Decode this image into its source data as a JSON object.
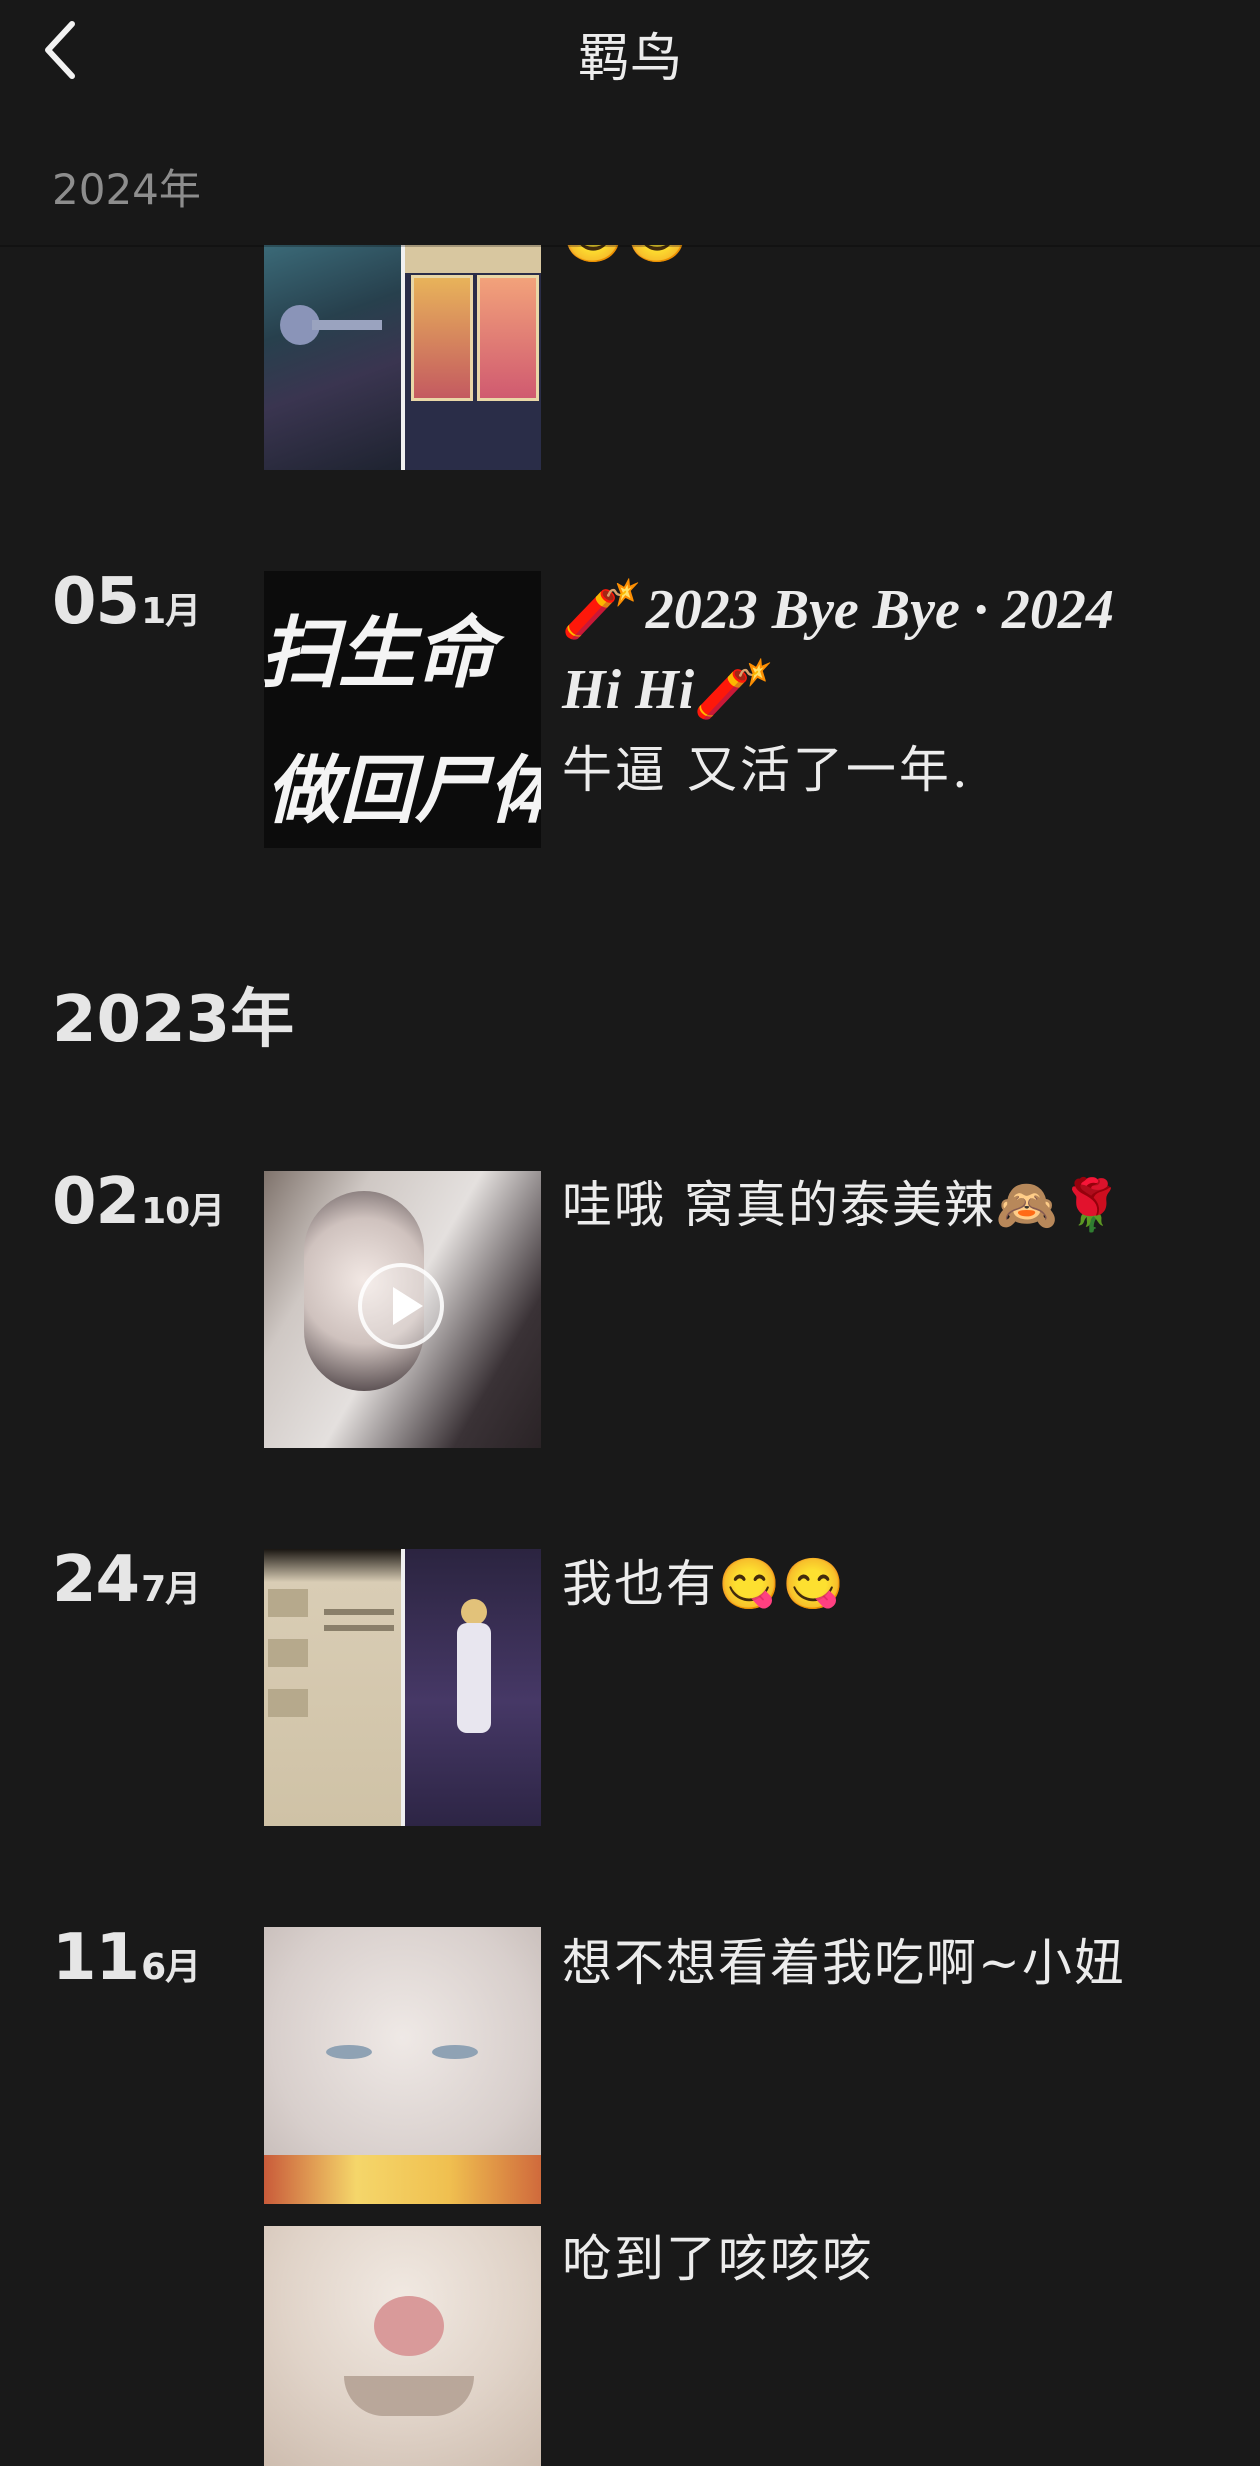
{
  "header": {
    "title": "羁鸟",
    "sticky_year": "2024年"
  },
  "sections": [
    {
      "year_label": "2023年"
    }
  ],
  "posts": [
    {
      "day": "05",
      "month": "1月",
      "caption": "🧨 2023 Bye Bye · 2024 Hi Hi🧨",
      "caption2": "牛逼 又活了一年.",
      "thumb_text_1": "扫生命",
      "thumb_text_2": "做回尸体"
    },
    {
      "day": "02",
      "month": "10月",
      "caption": "哇哦  窝真的泰美辣🙈🌹"
    },
    {
      "day": "24",
      "month": "7月",
      "caption": "我也有😋😋"
    },
    {
      "day": "11",
      "month": "6月",
      "caption": "想不想看着我吃啊~小妞"
    },
    {
      "caption": "呛到了咳咳咳"
    }
  ],
  "top_partial": {
    "caption_fragment": "😊😊"
  },
  "colors": {
    "background": "#191919",
    "header": "#181818",
    "text": "#e8e8e8",
    "muted": "#8d8d8d",
    "accent_red": "#e02020"
  }
}
